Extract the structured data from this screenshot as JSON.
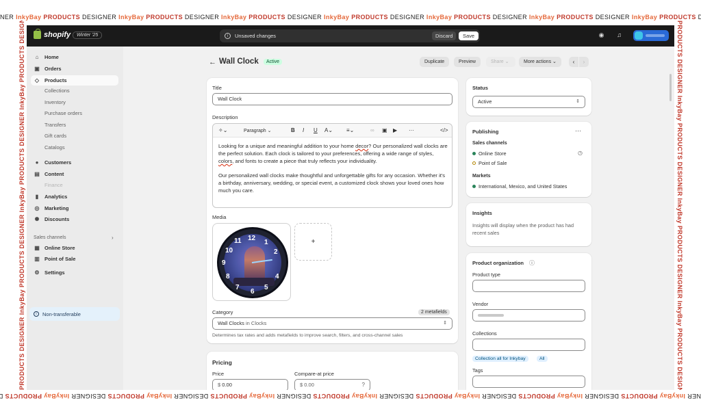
{
  "watermark": {
    "top_segments": [
      {
        "text": "NER ",
        "tone": "black"
      },
      {
        "text": "InkyBay ",
        "tone": "orange"
      },
      {
        "text": "PRODUCTS ",
        "tone": "red"
      },
      {
        "text": "DESIGNER ",
        "tone": "black"
      },
      {
        "text": "InkyBay ",
        "tone": "orange"
      },
      {
        "text": "PRODUCTS ",
        "tone": "red"
      },
      {
        "text": "DESIGNER ",
        "tone": "black"
      },
      {
        "text": "InkyBay ",
        "tone": "orange"
      },
      {
        "text": "PRODUCTS ",
        "tone": "red"
      },
      {
        "text": "DESIGNER ",
        "tone": "black"
      },
      {
        "text": "InkyBay ",
        "tone": "orange"
      },
      {
        "text": "PRODUCTS ",
        "tone": "red"
      },
      {
        "text": "DESIGNER ",
        "tone": "black"
      },
      {
        "text": "InkyBay ",
        "tone": "orange"
      },
      {
        "text": "PRODUCTS ",
        "tone": "red"
      },
      {
        "text": "DESIGNER ",
        "tone": "black"
      },
      {
        "text": "InkyBay ",
        "tone": "orange"
      },
      {
        "text": "PRODUCTS ",
        "tone": "red"
      },
      {
        "text": "DESIGNER ",
        "tone": "black"
      },
      {
        "text": "InkyBay ",
        "tone": "orange"
      },
      {
        "text": "PRODUCTS ",
        "tone": "red"
      },
      {
        "text": "DESIGNER ",
        "tone": "black"
      },
      {
        "text": "InkyBay ",
        "tone": "orange"
      },
      {
        "text": "PRODUCTS ",
        "tone": "red"
      },
      {
        "text": "DE",
        "tone": "black"
      }
    ],
    "side_text": "PRODUCTS DESIGNER InkyBay PRODUCTS DESIGNER InkyBay PRODUCTS DESIGNER InkyBay PRODUCTS DESIGNER InkyBay PRODUCTS DESIGNER"
  },
  "topbar": {
    "brand": "shopify",
    "edition": "Winter '25",
    "unsaved_message": "Unsaved changes",
    "discard_label": "Discard",
    "save_label": "Save"
  },
  "sidebar": {
    "items": [
      {
        "label": "Home",
        "icon": "home-icon",
        "glyph": "⌂"
      },
      {
        "label": "Orders",
        "icon": "orders-icon",
        "glyph": "▣"
      },
      {
        "label": "Products",
        "icon": "tag-icon",
        "glyph": "◇"
      }
    ],
    "product_subitems": [
      "Collections",
      "Inventory",
      "Purchase orders",
      "Transfers",
      "Gift cards",
      "Catalogs"
    ],
    "items2": [
      {
        "label": "Customers",
        "icon": "person-icon",
        "glyph": "●"
      },
      {
        "label": "Content",
        "icon": "content-icon",
        "glyph": "▤"
      }
    ],
    "finance_label": "Finance",
    "items3": [
      {
        "label": "Analytics",
        "icon": "analytics-icon",
        "glyph": "▮"
      },
      {
        "label": "Marketing",
        "icon": "target-icon",
        "glyph": "◎"
      },
      {
        "label": "Discounts",
        "icon": "discount-icon",
        "glyph": "✺"
      }
    ],
    "sales_channels_label": "Sales channels",
    "channels": [
      {
        "label": "Online Store",
        "icon": "store-icon",
        "glyph": "▦"
      },
      {
        "label": "Point of Sale",
        "icon": "pos-icon",
        "glyph": "▥"
      }
    ],
    "settings_label": "Settings",
    "nontransferable_label": "Non-transferable"
  },
  "header": {
    "title": "Wall Clock",
    "status_badge": "Active",
    "duplicate_label": "Duplicate",
    "preview_label": "Preview",
    "share_label": "Share",
    "more_actions_label": "More actions"
  },
  "product": {
    "title_label": "Title",
    "title_value": "Wall Clock",
    "description_label": "Description",
    "paragraph_label": "Paragraph",
    "desc_p1_a": "Looking for a unique and meaningful addition to your home ",
    "desc_p1_b": "decor",
    "desc_p1_c": "? Our personalized wall clocks are the perfect solution. Each clock is tailored to your preferences, offering a wide range of styles, ",
    "desc_p1_d": "colors",
    "desc_p1_e": ", and fonts to create a piece that truly reflects your individuality.",
    "desc_p2": "Our personalized wall clocks make thoughtful and unforgettable gifts for any occasion. Whether it's a birthday, anniversary, wedding, or special event, a customized clock shows your loved ones how much you care.",
    "media_label": "Media",
    "add_media_symbol": "+",
    "clock_numbers": [
      {
        "num": "12"
      },
      {
        "num": "1"
      },
      {
        "num": "11"
      },
      {
        "num": "10"
      },
      {
        "num": "2"
      },
      {
        "num": "9"
      },
      {
        "num": "8"
      },
      {
        "num": "4"
      },
      {
        "num": "7"
      },
      {
        "num": "5"
      },
      {
        "num": "6"
      }
    ],
    "category_label": "Category",
    "metafields_badge": "2 metafields",
    "category_value": "Wall Clocks",
    "category_in": " in Clocks",
    "category_help": "Determines tax rates and adds metafields to improve search, filters, and cross-channel sales"
  },
  "pricing": {
    "heading": "Pricing",
    "price_label": "Price",
    "price_value": "0.00",
    "compare_label": "Compare-at price",
    "compare_value": "0.00",
    "currency": "$"
  },
  "status_card": {
    "heading": "Status",
    "value": "Active"
  },
  "publishing": {
    "heading": "Publishing",
    "sales_channels_label": "Sales channels",
    "channel1": "Online Store",
    "channel2": "Point of Sale",
    "markets_label": "Markets",
    "markets_value": "International, Mexico, and United States",
    "colors": {
      "published": "#29845a",
      "pending": "#b28500"
    }
  },
  "insights": {
    "heading": "Insights",
    "text": "Insights will display when the product has had recent sales"
  },
  "organization": {
    "heading": "Product organization",
    "product_type_label": "Product type",
    "vendor_label": "Vendor",
    "collections_label": "Collections",
    "collection_tag": "Collection all for Inkybay",
    "all_tag": "All",
    "tags_label": "Tags"
  }
}
